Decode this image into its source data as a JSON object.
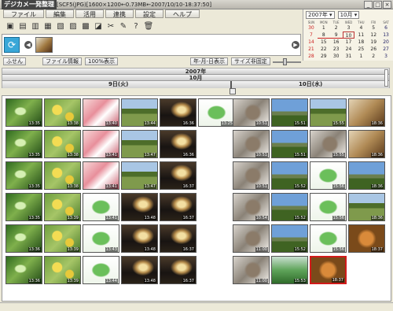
{
  "window": {
    "app_name": "デジカメ一発整理",
    "info": "[SCF5(JPG)[1600×1200←0.73MB←2007/10/10-18:37:50]",
    "buttons": [
      "_",
      "□",
      "×"
    ]
  },
  "menu": [
    "ファイル",
    "編集",
    "活用",
    "連携",
    "設定",
    "ヘルプ"
  ],
  "toolbar_icons": [
    "open-icon",
    "save-icon",
    "copy-icon",
    "print-icon",
    "print-icon",
    "mail-icon",
    "stamp-icon",
    "rotate-icon",
    "scissors-icon",
    "tool-icon",
    "help-icon",
    "trash-icon"
  ],
  "toolbar_glyphs": [
    "▣",
    "▤",
    "▥",
    "▦",
    "▧",
    "▨",
    "▩",
    "◪",
    "✂",
    "✎",
    "?",
    "🗑"
  ],
  "view_buttons": {
    "fusen": "ふせん",
    "file_info": "ファイル情報",
    "zoom": "100%表示",
    "date_display": "年-月-日表示",
    "size_fixed": "サイズ非固定"
  },
  "calendar": {
    "year_label": "2007年",
    "month_label": "10月",
    "dow": [
      "SUN",
      "MON",
      "TUE",
      "WED",
      "THU",
      "FRI",
      "SAT"
    ],
    "days": [
      "30",
      "1",
      "2",
      "3",
      "4",
      "5",
      "6",
      "7",
      "8",
      "9",
      "10",
      "11",
      "12",
      "13",
      "14",
      "15",
      "16",
      "17",
      "18",
      "19",
      "20",
      "21",
      "22",
      "23",
      "24",
      "25",
      "26",
      "27",
      "28",
      "29",
      "30",
      "31",
      "1",
      "2",
      "3"
    ],
    "current_day": "10"
  },
  "timeline": {
    "year": "2007年",
    "month": "10月",
    "day_left": "9日(火)",
    "day_right": "10日(水)"
  },
  "photos": [
    {
      "t": "13:35",
      "k": "p-leaf"
    },
    {
      "t": "13:38",
      "k": "p-flower"
    },
    {
      "t": "13:40",
      "k": "p-red"
    },
    {
      "t": "13:44",
      "k": "p-field"
    },
    {
      "t": "16:36",
      "k": "p-sunset"
    },
    {
      "t": "13:25",
      "k": "p-herb"
    },
    {
      "t": "10:51",
      "k": "p-cat"
    },
    {
      "t": "15:51",
      "k": "p-mount"
    },
    {
      "t": "15:55",
      "k": "p-field"
    },
    {
      "t": "18:36",
      "k": "p-close"
    },
    {
      "t": "13:35",
      "k": "p-leaf"
    },
    {
      "t": "13:38",
      "k": "p-flower"
    },
    {
      "t": "13:41",
      "k": "p-red"
    },
    {
      "t": "13:47",
      "k": "p-field"
    },
    {
      "t": "16:36",
      "k": "p-sunset"
    },
    {
      "t": "10:51",
      "k": "p-cat"
    },
    {
      "t": "15:51",
      "k": "p-mount"
    },
    {
      "t": "15:55",
      "k": "p-cat"
    },
    {
      "t": "18:36",
      "k": "p-close"
    },
    {
      "t": "13:35",
      "k": "p-leaf"
    },
    {
      "t": "13:38",
      "k": "p-flower"
    },
    {
      "t": "13:41",
      "k": "p-red"
    },
    {
      "t": "13:47",
      "k": "p-field"
    },
    {
      "t": "16:37",
      "k": "p-sunset"
    },
    {
      "t": "10:51",
      "k": "p-cat"
    },
    {
      "t": "15:52",
      "k": "p-mount"
    },
    {
      "t": "15:56",
      "k": "p-herb"
    },
    {
      "t": "18:36",
      "k": "p-mount"
    },
    {
      "t": "13:35",
      "k": "p-leaf"
    },
    {
      "t": "13:39",
      "k": "p-flower"
    },
    {
      "t": "13:41",
      "k": "p-herb"
    },
    {
      "t": "13:48",
      "k": "p-sunset"
    },
    {
      "t": "16:37",
      "k": "p-sunset"
    },
    {
      "t": "10:54",
      "k": "p-cat"
    },
    {
      "t": "15:52",
      "k": "p-mount"
    },
    {
      "t": "15:56",
      "k": "p-herb"
    },
    {
      "t": "18:36",
      "k": "p-field"
    },
    {
      "t": "13:36",
      "k": "p-leaf"
    },
    {
      "t": "13:39",
      "k": "p-flower"
    },
    {
      "t": "13:43",
      "k": "p-herb"
    },
    {
      "t": "13:48",
      "k": "p-sunset"
    },
    {
      "t": "16:37",
      "k": "p-sunset"
    },
    {
      "t": "11:00",
      "k": "p-cat"
    },
    {
      "t": "15:52",
      "k": "p-mount"
    },
    {
      "t": "15:56",
      "k": "p-herb"
    },
    {
      "t": "18:37",
      "k": "p-catbox"
    },
    {
      "t": "13:36",
      "k": "p-leaf"
    },
    {
      "t": "13:39",
      "k": "p-flower"
    },
    {
      "t": "13:44",
      "k": "p-herb"
    },
    {
      "t": "13:48",
      "k": "p-sunset"
    },
    {
      "t": "16:37",
      "k": "p-sunset"
    },
    {
      "t": "11:00",
      "k": "p-cat"
    },
    {
      "t": "15:53",
      "k": "p-plants"
    },
    {
      "t": "18:37",
      "k": "p-catbox",
      "selected": true
    }
  ]
}
